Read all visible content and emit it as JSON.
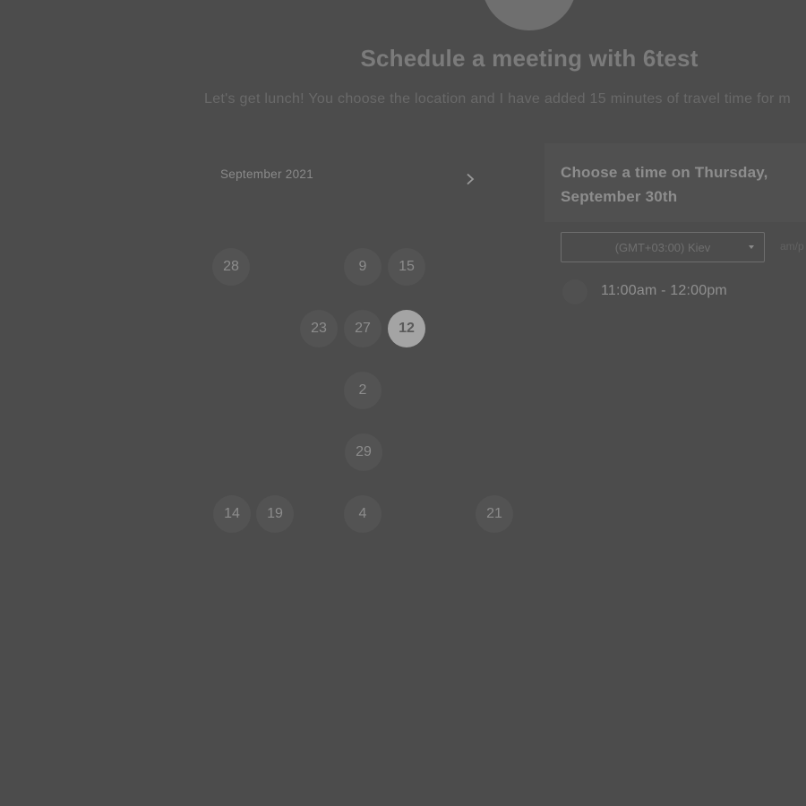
{
  "header": {
    "title": "Schedule a meeting with 6test",
    "description": "Let's get lunch! You choose the location and I have added 15 minutes of travel time for m"
  },
  "calendar": {
    "month_label": "September 2021",
    "next_icon": "chevron-right-icon",
    "weekdays": "",
    "selected_day": "12",
    "days": [
      {
        "label": "28",
        "selected": false
      },
      {
        "label": "9",
        "selected": false
      },
      {
        "label": "15",
        "selected": false
      },
      {
        "label": "23",
        "selected": false
      },
      {
        "label": "27",
        "selected": false
      },
      {
        "label": "12",
        "selected": true
      },
      {
        "label": "2",
        "selected": false
      },
      {
        "label": "29",
        "selected": false
      },
      {
        "label": "14",
        "selected": false
      },
      {
        "label": "19",
        "selected": false
      },
      {
        "label": "4",
        "selected": false
      },
      {
        "label": "21",
        "selected": false
      }
    ]
  },
  "time_panel": {
    "title": "Choose a time on Thursday, September 30th",
    "timezone": "(GMT+03:00) Kiev",
    "ampm": "am/p",
    "slots": [
      {
        "label": "11:00am - 12:00pm"
      }
    ]
  },
  "colors": {
    "background": "#4c4c4c",
    "selected_day": "#a4a4a4"
  }
}
